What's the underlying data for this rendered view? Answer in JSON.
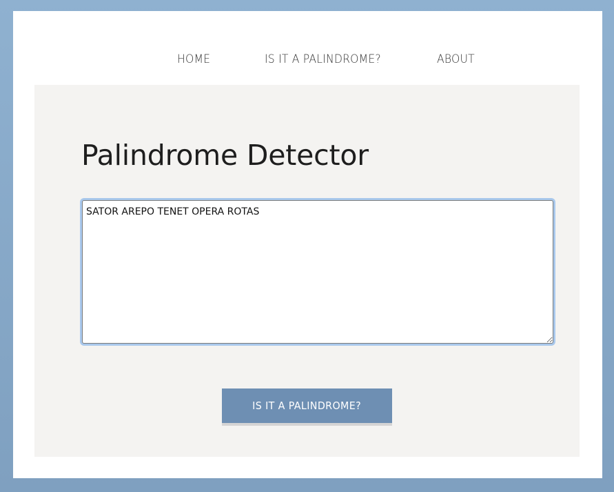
{
  "nav": {
    "items": [
      {
        "label": "HOME"
      },
      {
        "label": "IS IT A PALINDROME?"
      },
      {
        "label": "ABOUT"
      }
    ]
  },
  "main": {
    "title": "Palindrome Detector",
    "textarea": {
      "value": "SATOR AREPO TENET OPERA ROTAS"
    },
    "button": {
      "label": "IS IT A PALINDROME?"
    }
  },
  "colors": {
    "background_border": "#8fb1d0",
    "panel": "#f4f3f1",
    "button": "#6e8fb3",
    "focus_ring": "#a9c8ec"
  }
}
